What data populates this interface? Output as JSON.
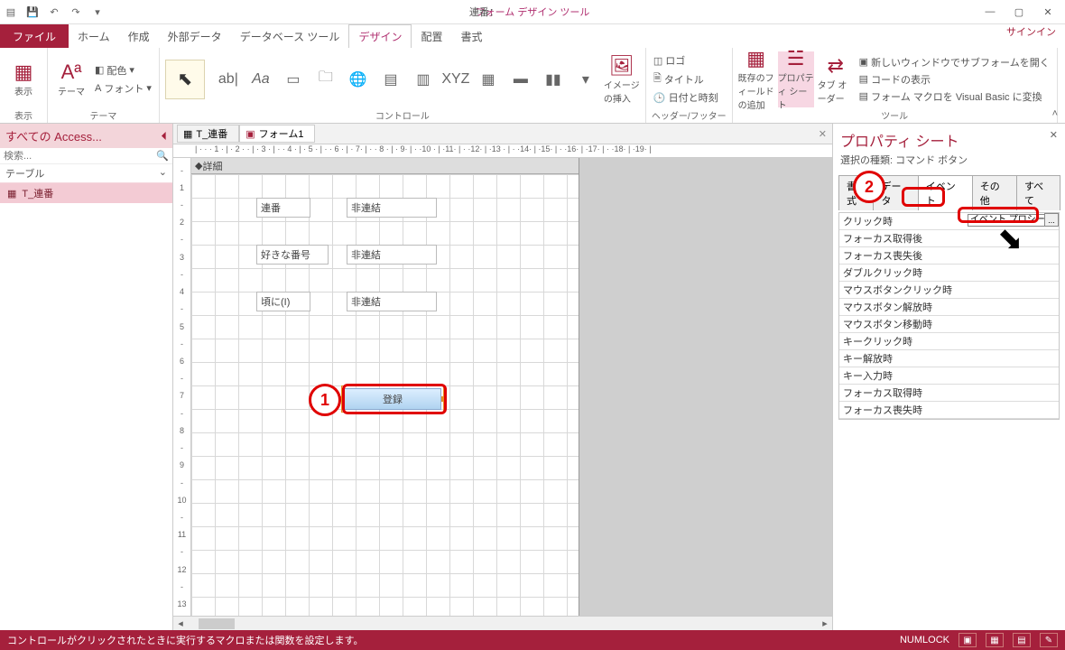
{
  "titlebar": {
    "tool_title": "フォーム デザイン ツール",
    "win_label": "連番："
  },
  "tabs": {
    "file": "ファイル",
    "home": "ホーム",
    "create": "作成",
    "external": "外部データ",
    "dbtools": "データベース ツール",
    "design": "デザイン",
    "arrange": "配置",
    "format": "書式",
    "signin": "サインイン"
  },
  "ribbon": {
    "view": "表示",
    "theme": "テーマ",
    "colors": "配色",
    "fonts": "フォント",
    "controls": "コントロール",
    "image_insert": "イメージの挿入",
    "header_footer": "ヘッダー/フッター",
    "logo": "ロゴ",
    "title": "タイトル",
    "datetime": "日付と時刻",
    "existing_fields": "既存のフィールドの追加",
    "prop_sheet": "プロパティ シート",
    "tab_order": "タブ オーダー",
    "new_window": "新しいウィンドウでサブフォームを開く",
    "view_code": "コードの表示",
    "convert_macro": "フォーム マクロを Visual Basic に変換",
    "tools": "ツール"
  },
  "nav": {
    "title": "すべての Access...",
    "search_placeholder": "検索...",
    "group": "テーブル",
    "item1": "T_連番"
  },
  "doc_tabs": {
    "t1": "T_連番",
    "t2": "フォーム1"
  },
  "design": {
    "detail": "詳細",
    "lbl_renban": "連番",
    "lbl_suki": "好きな番号",
    "lbl_ta": "頃に(I)",
    "unbound": "非連結",
    "register": "登録"
  },
  "ruler_h": "| · · · 1 · | · 2 · · | · 3 · | · · 4 · | · 5 · | · · 6 · | · 7· | · · 8 · | · 9· | · ·10 · | ·11· | · ·12· | ·13 · | · ·14· | ·15· | · ·16· | ·17· | · ·18· | ·19· |",
  "ruler_v": [
    "-",
    "1",
    "-",
    "2",
    "-",
    "3",
    "-",
    "4",
    "-",
    "5",
    "-",
    "6",
    "-",
    "7",
    "-",
    "8",
    "-",
    "9",
    "-",
    "10",
    "-",
    "11",
    "-",
    "12",
    "-",
    "13",
    "-"
  ],
  "anno": {
    "one": "1",
    "two": "2"
  },
  "prop": {
    "title": "プロパティ シート",
    "subtitle": "選択の種類: コマンド ボタン",
    "tabs": {
      "format": "書式",
      "data": "データ",
      "event": "イベント",
      "other": "その他",
      "all": "すべて"
    },
    "rows": [
      "クリック時",
      "フォーカス取得後",
      "フォーカス喪失後",
      "ダブルクリック時",
      "マウスボタンクリック時",
      "マウスボタン解放時",
      "マウスボタン移動時",
      "キークリック時",
      "キー解放時",
      "キー入力時",
      "フォーカス取得時",
      "フォーカス喪失時"
    ],
    "val_event_proc": "イベント プロシー",
    "ellipsis": "..."
  },
  "status": {
    "msg": "コントロールがクリックされたときに実行するマクロまたは関数を設定します。",
    "numlock": "NUMLOCK"
  }
}
